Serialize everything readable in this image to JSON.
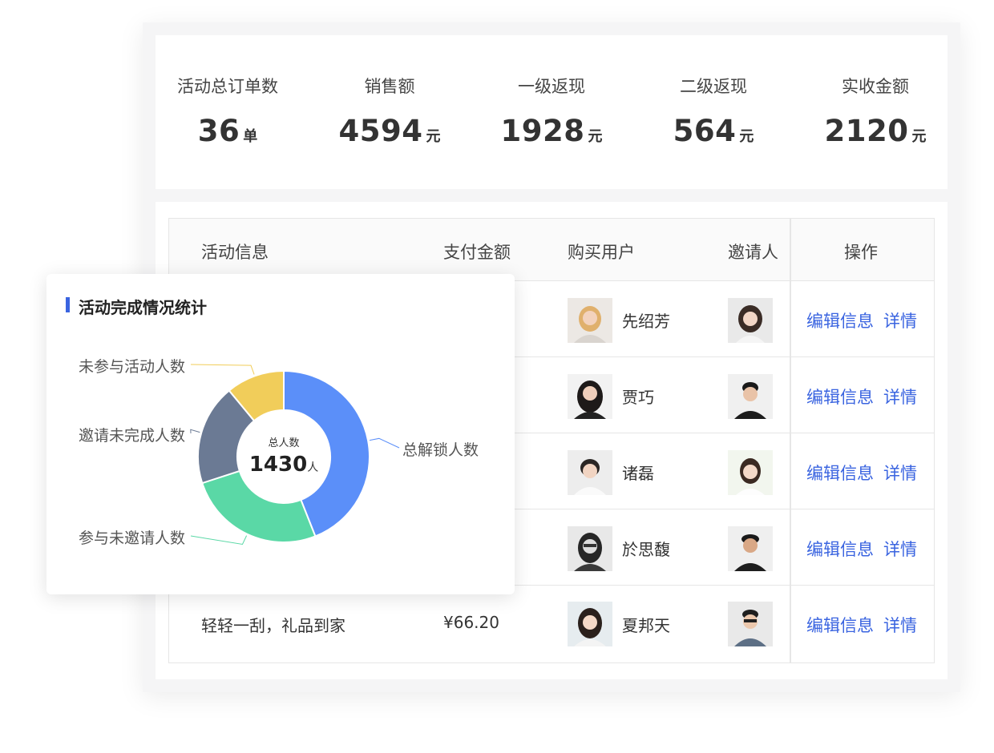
{
  "stats": [
    {
      "label": "活动总订单数",
      "value": "36",
      "unit": "单"
    },
    {
      "label": "销售额",
      "value": "4594",
      "unit": "元"
    },
    {
      "label": "一级返现",
      "value": "1928",
      "unit": "元"
    },
    {
      "label": "二级返现",
      "value": "564",
      "unit": "元"
    },
    {
      "label": "实收金额",
      "value": "2120",
      "unit": "元"
    }
  ],
  "table": {
    "headers": {
      "activity": "活动信息",
      "amount": "支付金额",
      "buyer": "购买用户",
      "inviter": "邀请人",
      "actions": "操作"
    },
    "edit_label": "编辑信息",
    "detail_label": "详情",
    "rows": [
      {
        "activity": "",
        "amount": "",
        "buyer": "先绍芳"
      },
      {
        "activity": "",
        "amount": "",
        "buyer": "贾巧"
      },
      {
        "activity": "",
        "amount": "",
        "buyer": "诸磊"
      },
      {
        "activity": "",
        "amount": "",
        "buyer": "於思馥"
      },
      {
        "activity": "轻轻一刮，礼品到家",
        "amount": "¥66.20",
        "buyer": "夏邦天"
      }
    ]
  },
  "popup": {
    "title": "活动完成情况统计",
    "accent_color": "#3a64e0",
    "center_label": "总人数",
    "center_value": "1430",
    "center_unit": "人"
  },
  "chart_data": {
    "type": "pie",
    "donut": true,
    "title": "活动完成情况统计",
    "total": 1430,
    "slices": [
      {
        "label": "总解锁人数",
        "share": 0.44,
        "color": "#5b8ff9"
      },
      {
        "label": "参与未邀请人数",
        "share": 0.26,
        "color": "#5ad8a6"
      },
      {
        "label": "邀请未完成人数",
        "share": 0.19,
        "color": "#6b7a94"
      },
      {
        "label": "未参与活动人数",
        "share": 0.11,
        "color": "#f1cd5a"
      }
    ]
  }
}
